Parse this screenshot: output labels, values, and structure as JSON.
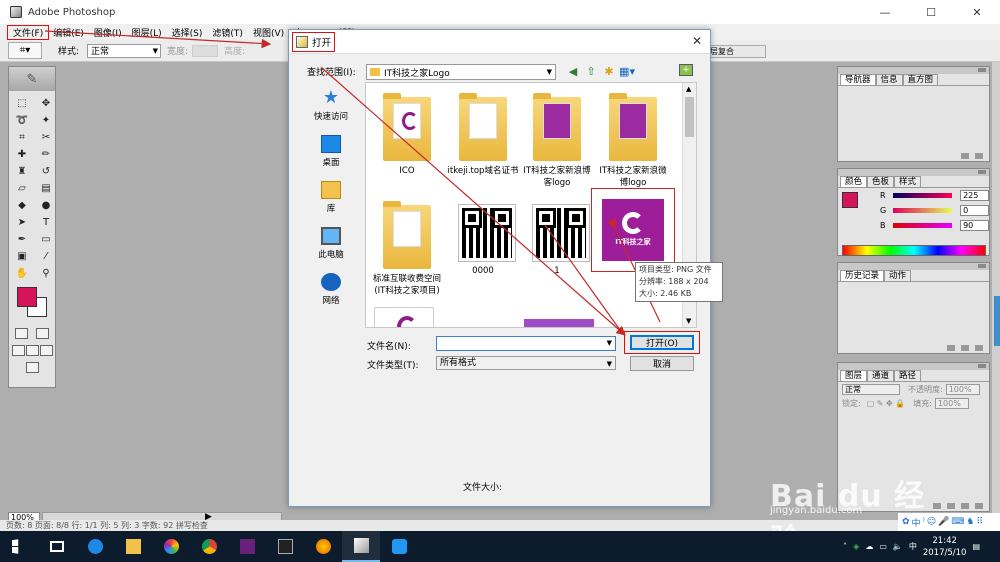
{
  "app": {
    "title": "Adobe Photoshop",
    "window_controls": [
      "—",
      "☐",
      "✕"
    ]
  },
  "menubar": {
    "items": [
      "文件(F)",
      "编辑(E)",
      "图像(I)",
      "图层(L)",
      "选择(S)",
      "滤镜(T)",
      "视图(V)",
      "窗口(W)",
      "帮助(H)"
    ]
  },
  "options_bar": {
    "style_label": "样式:",
    "style_value": "正常",
    "width_label": "宽度:",
    "height_label": "高度:",
    "palette_well": "层复合"
  },
  "toolbox": {
    "foreground_color": "#d6145a",
    "background_color": "#ffffff"
  },
  "dialog": {
    "title": "打开",
    "look_in_label": "查找范围(I):",
    "look_in_value": "IT科技之家Logo",
    "places": [
      {
        "label": "快速访问",
        "icon": "star-icon"
      },
      {
        "label": "桌面",
        "icon": "desktop-icon"
      },
      {
        "label": "库",
        "icon": "library-icon"
      },
      {
        "label": "此电脑",
        "icon": "computer-icon"
      },
      {
        "label": "网络",
        "icon": "network-icon"
      }
    ],
    "files": [
      {
        "name": "ICO",
        "kind": "folder"
      },
      {
        "name": "itkeji.top域名证书",
        "kind": "folder"
      },
      {
        "name": "IT科技之家新浪博客logo",
        "kind": "folder"
      },
      {
        "name": "IT科技之家新浪微博logo",
        "kind": "folder"
      },
      {
        "name": "标准互联收费空间(IT科技之家项目)",
        "kind": "folder"
      },
      {
        "name": "0000",
        "kind": "qr"
      },
      {
        "name": "1",
        "kind": "qr"
      },
      {
        "name": "",
        "kind": "png"
      }
    ],
    "logo_text": "IT科技之家",
    "tooltip": {
      "type": "项目类型: PNG 文件",
      "dimensions": "分辨率: 188 x 204",
      "size": "大小: 2.46 KB"
    },
    "filename_label": "文件名(N):",
    "filename_value": "",
    "filetype_label": "文件类型(T):",
    "filetype_value": "所有格式",
    "open_button": "打开(O)",
    "cancel_button": "取消",
    "file_size_label": "文件大小:"
  },
  "palettes": {
    "navigator_tabs": [
      "导航器",
      "信息",
      "直方图"
    ],
    "color_tabs": [
      "颜色",
      "色板",
      "样式"
    ],
    "color": {
      "R": "225",
      "G": "0",
      "B": "90"
    },
    "history_tabs": [
      "历史记录",
      "动作"
    ],
    "layers_tabs": [
      "图层",
      "通道",
      "路径"
    ],
    "layers": {
      "blend_mode": "正常",
      "opacity_label": "不透明度:",
      "opacity_value": "100%",
      "lock_label": "锁定:",
      "fill_label": "填充:",
      "fill_value": "100%"
    }
  },
  "status": {
    "zoom": "100%",
    "text": "页数: 8  页面: 8/8  行: 1/1  列: 5  列: 3  字数: 92  拼写检查"
  },
  "watermark": {
    "brand": "Bai du 经验",
    "url": "jingyan.baidu.com"
  },
  "taskbar": {
    "time": "21:42",
    "date": "2017/5/10",
    "input_method": "中"
  },
  "colors": {
    "annotation": "#d11111",
    "accent": "#0078d7"
  }
}
